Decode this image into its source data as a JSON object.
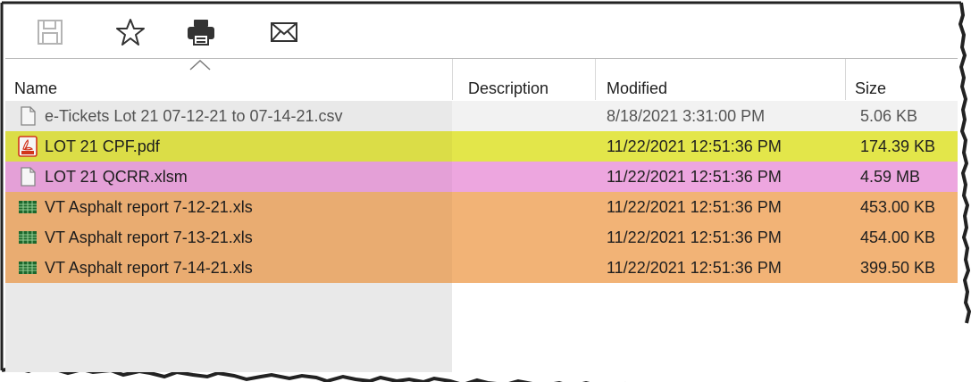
{
  "toolbar": {
    "buttons": [
      {
        "name": "save-icon"
      },
      {
        "name": "star-icon"
      },
      {
        "name": "print-icon"
      },
      {
        "name": "email-icon"
      }
    ]
  },
  "columns": {
    "name": "Name",
    "description": "Description",
    "modified": "Modified",
    "size": "Size",
    "sort_indicator": "sort-ascending-icon"
  },
  "files": [
    {
      "name": "e-Tickets Lot 21 07-12-21 to 07-14-21.csv",
      "description": "",
      "modified": "8/18/2021 3:31:00 PM",
      "size": "5.06 KB",
      "icon": "generic-file-icon",
      "highlight": "#f2f2f2"
    },
    {
      "name": "LOT 21 CPF.pdf",
      "description": "",
      "modified": "11/22/2021 12:51:36 PM",
      "size": "174.39 KB",
      "icon": "pdf-icon",
      "highlight": "#e3e64a"
    },
    {
      "name": "LOT 21 QCRR.xlsm",
      "description": "",
      "modified": "11/22/2021 12:51:36 PM",
      "size": "4.59 MB",
      "icon": "generic-file-icon",
      "highlight": "#eda6df"
    },
    {
      "name": "VT Asphalt report 7-12-21.xls",
      "description": "",
      "modified": "11/22/2021 12:51:36 PM",
      "size": "453.00 KB",
      "icon": "spreadsheet-icon",
      "highlight": "#f2b376"
    },
    {
      "name": "VT Asphalt report 7-13-21.xls",
      "description": "",
      "modified": "11/22/2021 12:51:36 PM",
      "size": "454.00 KB",
      "icon": "spreadsheet-icon",
      "highlight": "#f2b376"
    },
    {
      "name": "VT Asphalt report 7-14-21.xls",
      "description": "",
      "modified": "11/22/2021 12:51:36 PM",
      "size": "399.50 KB",
      "icon": "spreadsheet-icon",
      "highlight": "#f2b376"
    }
  ]
}
